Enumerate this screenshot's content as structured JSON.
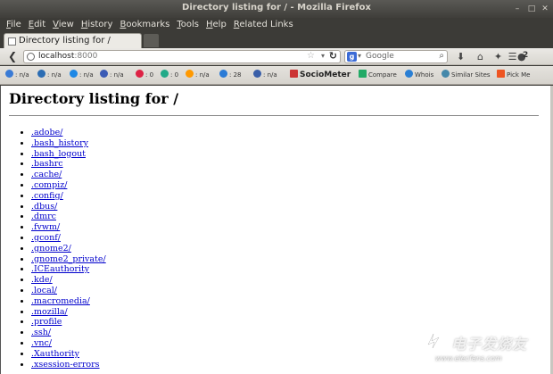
{
  "window": {
    "title": "Directory listing for / - Mozilla Firefox",
    "controls": [
      "–",
      "□",
      "✕"
    ]
  },
  "menu": [
    "File",
    "Edit",
    "View",
    "History",
    "Bookmarks",
    "Tools",
    "Help",
    "Related Links"
  ],
  "tab": {
    "title": "Directory listing for /"
  },
  "nav": {
    "url_host": "localhost",
    "url_port": ":8000",
    "search_placeholder": "Google",
    "addon_badge": "2"
  },
  "bookmarks": [
    {
      "label": ": n/a",
      "color": "#3a7bd5"
    },
    {
      "label": ": n/a",
      "color": "#2c6db3"
    },
    {
      "label": ": n/a",
      "color": "#1e88e5"
    },
    {
      "label": ": n/a",
      "color": "#3b5bb5"
    },
    {
      "label": ": 0",
      "color": "#d24"
    },
    {
      "label": ": 0",
      "color": "#2a8"
    },
    {
      "label": ": n/a",
      "color": "#f90"
    },
    {
      "label": ": 28",
      "color": "#2b7bd6"
    },
    {
      "label": ": n/a",
      "color": "#3a5fa8"
    },
    {
      "label": "SocioMeter",
      "color": "#c33"
    },
    {
      "label": "Compare",
      "color": "#2a6"
    },
    {
      "label": "Whois",
      "color": "#2a7fd4"
    },
    {
      "label": "Similar Sites",
      "color": "#48a"
    },
    {
      "label": "Pick Me",
      "color": "#e52"
    }
  ],
  "page": {
    "heading": "Directory listing for /",
    "entries": [
      ".adobe/",
      ".bash_history",
      ".bash_logout",
      ".bashrc",
      ".cache/",
      ".compiz/",
      ".config/",
      ".dbus/",
      ".dmrc",
      ".fvwm/",
      ".gconf/",
      ".gnome2/",
      ".gnome2_private/",
      ".ICEauthority",
      ".kde/",
      ".local/",
      ".macromedia/",
      ".mozilla/",
      ".profile",
      ".ssh/",
      ".vnc/",
      ".Xauthority",
      ".xsession-errors"
    ]
  },
  "watermark": {
    "brand": "电子发烧友",
    "site": "www.elecfans.com"
  }
}
